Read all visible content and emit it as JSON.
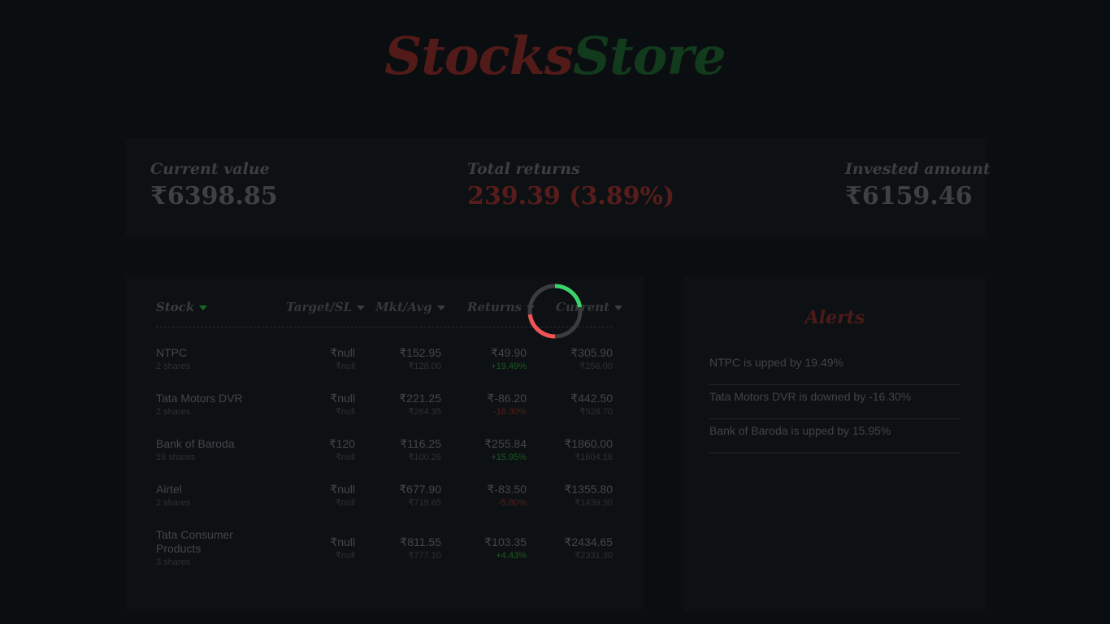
{
  "brand": {
    "part1": "Stocks",
    "part2": "Store"
  },
  "summary": {
    "current_value": {
      "label": "Current value",
      "value": "₹6398.85"
    },
    "total_returns": {
      "label": "Total returns",
      "value": "239.39 (3.89%)"
    },
    "invested_amount": {
      "label": "Invested amount",
      "value": "₹6159.46"
    }
  },
  "holdings": {
    "columns": [
      "Stock",
      "Target/SL",
      "Mkt/Avg",
      "Returns",
      "Current"
    ],
    "rows": [
      {
        "name": "NTPC",
        "shares": "2 shares",
        "target": "₹null",
        "sl": "₹null",
        "mkt": "₹152.95",
        "avg": "₹128.00",
        "returns": "₹49.90",
        "returns_pct": "+19.49%",
        "returns_dir": "pos",
        "current": "₹305.90",
        "invested": "₹256.00"
      },
      {
        "name": "Tata Motors DVR",
        "shares": "2 shares",
        "target": "₹null",
        "sl": "₹null",
        "mkt": "₹221.25",
        "avg": "₹264.35",
        "returns": "₹-86.20",
        "returns_pct": "-16.30%",
        "returns_dir": "neg",
        "current": "₹442.50",
        "invested": "₹528.70"
      },
      {
        "name": "Bank of Baroda",
        "shares": "16 shares",
        "target": "₹120",
        "sl": "₹null",
        "mkt": "₹116.25",
        "avg": "₹100.26",
        "returns": "₹255.84",
        "returns_pct": "+15.95%",
        "returns_dir": "pos",
        "current": "₹1860.00",
        "invested": "₹1604.16"
      },
      {
        "name": "Airtel",
        "shares": "2 shares",
        "target": "₹null",
        "sl": "₹null",
        "mkt": "₹677.90",
        "avg": "₹719.65",
        "returns": "₹-83.50",
        "returns_pct": "-5.80%",
        "returns_dir": "neg",
        "current": "₹1355.80",
        "invested": "₹1439.30"
      },
      {
        "name": "Tata Consumer Products",
        "shares": "3 shares",
        "target": "₹null",
        "sl": "₹null",
        "mkt": "₹811.55",
        "avg": "₹777.10",
        "returns": "₹103.35",
        "returns_pct": "+4.43%",
        "returns_dir": "pos",
        "current": "₹2434.65",
        "invested": "₹2331.30"
      }
    ]
  },
  "alerts": {
    "title": "Alerts",
    "items": [
      "NTPC is upped by 19.49%",
      "Tata Motors DVR is downed by -16.30%",
      "Bank of Baroda is upped by 15.95%"
    ]
  },
  "spinner": {
    "colors": {
      "track": "#3a3c3e",
      "up": "#39d46a",
      "down": "#f05454"
    }
  },
  "colors": {
    "background": "#0b0e10",
    "card": "#0d1113",
    "positive": "#1a5a22",
    "negative": "#5b1d1c"
  }
}
